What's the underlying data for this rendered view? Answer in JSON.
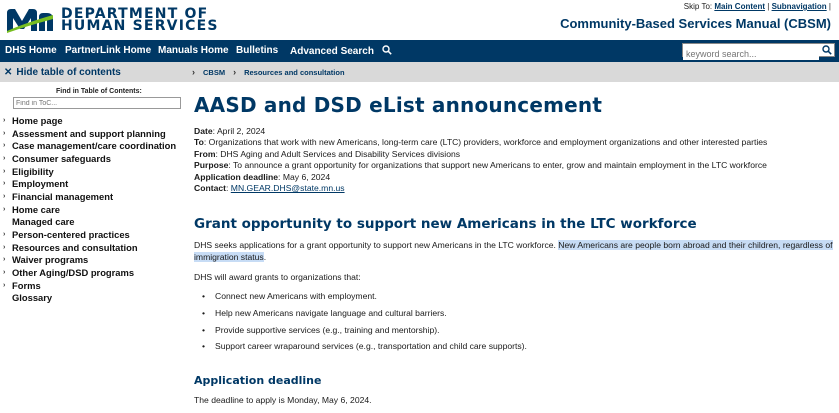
{
  "header": {
    "logo_line1": "DEPARTMENT OF",
    "logo_line2": "HUMAN SERVICES",
    "skip_label": "Skip To:",
    "skip_main": "Main Content",
    "skip_sep": "|",
    "skip_subnav": "Subnavigation",
    "skip_end": "|",
    "site_title": "Community-Based Services Manual (CBSM)"
  },
  "nav": {
    "items": [
      "DHS Home",
      "PartnerLink Home",
      "Manuals Home",
      "Bulletins",
      "Advanced Search"
    ],
    "search_placeholder": "keyword search..."
  },
  "subbar": {
    "hide_toc": "Hide table of contents",
    "breadcrumbs": [
      "CBSM",
      "Resources and consultation"
    ]
  },
  "sidebar": {
    "find_label": "Find in Table of Contents:",
    "find_placeholder": "Find in ToC...",
    "items": [
      {
        "label": "Home page",
        "expandable": true
      },
      {
        "label": "Assessment and support planning",
        "expandable": true
      },
      {
        "label": "Case management/care coordination",
        "expandable": true
      },
      {
        "label": "Consumer safeguards",
        "expandable": true
      },
      {
        "label": "Eligibility",
        "expandable": true
      },
      {
        "label": "Employment",
        "expandable": true
      },
      {
        "label": "Financial management",
        "expandable": true
      },
      {
        "label": "Home care",
        "expandable": true
      },
      {
        "label": "Managed care",
        "expandable": false
      },
      {
        "label": "Person-centered practices",
        "expandable": true
      },
      {
        "label": "Resources and consultation",
        "expandable": true
      },
      {
        "label": "Waiver programs",
        "expandable": true
      },
      {
        "label": "Other Aging/DSD programs",
        "expandable": true
      },
      {
        "label": "Forms",
        "expandable": true
      },
      {
        "label": "Glossary",
        "expandable": false
      }
    ]
  },
  "main": {
    "title": "AASD and DSD eList announcement",
    "meta": {
      "date_label": "Date",
      "date": ": April 2, 2024",
      "to_label": "To",
      "to": ": Organizations that work with new Americans, long-term care (LTC) providers, workforce and employment organizations and other interested parties",
      "from_label": "From",
      "from": ": DHS Aging and Adult Services and Disability Services divisions",
      "purpose_label": "Purpose",
      "purpose": ": To announce a grant opportunity for organizations that support new Americans to enter, grow and maintain employment in the LTC workforce",
      "deadline_label": "Application deadline",
      "deadline": ": May 6, 2024",
      "contact_label": "Contact",
      "contact_sep": ":",
      "contact_email": "MN.GEAR.DHS@state.mn.us"
    },
    "section_title": "Grant opportunity to support new Americans in the LTC workforce",
    "para1_plain": "DHS seeks applications for a grant opportunity to support new Americans in the LTC workforce. ",
    "para1_highlight": "New Americans are people born abroad and their children, regardless of immigration status",
    "para1_end": ".",
    "para2": "DHS will award grants to organizations that:",
    "bullets": [
      "Connect new Americans with employment.",
      "Help new Americans navigate language and cultural barriers.",
      "Provide supportive services (e.g., training and mentorship).",
      "Support career wraparound services (e.g., transportation and child care supports)."
    ],
    "deadline_title": "Application deadline",
    "deadline_text": "The deadline to apply is Monday, May 6, 2024."
  },
  "colors": {
    "brand_navy": "#003865",
    "brand_green": "#78BE21",
    "highlight": "#C7DCF5",
    "subbar_grey": "#D9D9D9"
  }
}
